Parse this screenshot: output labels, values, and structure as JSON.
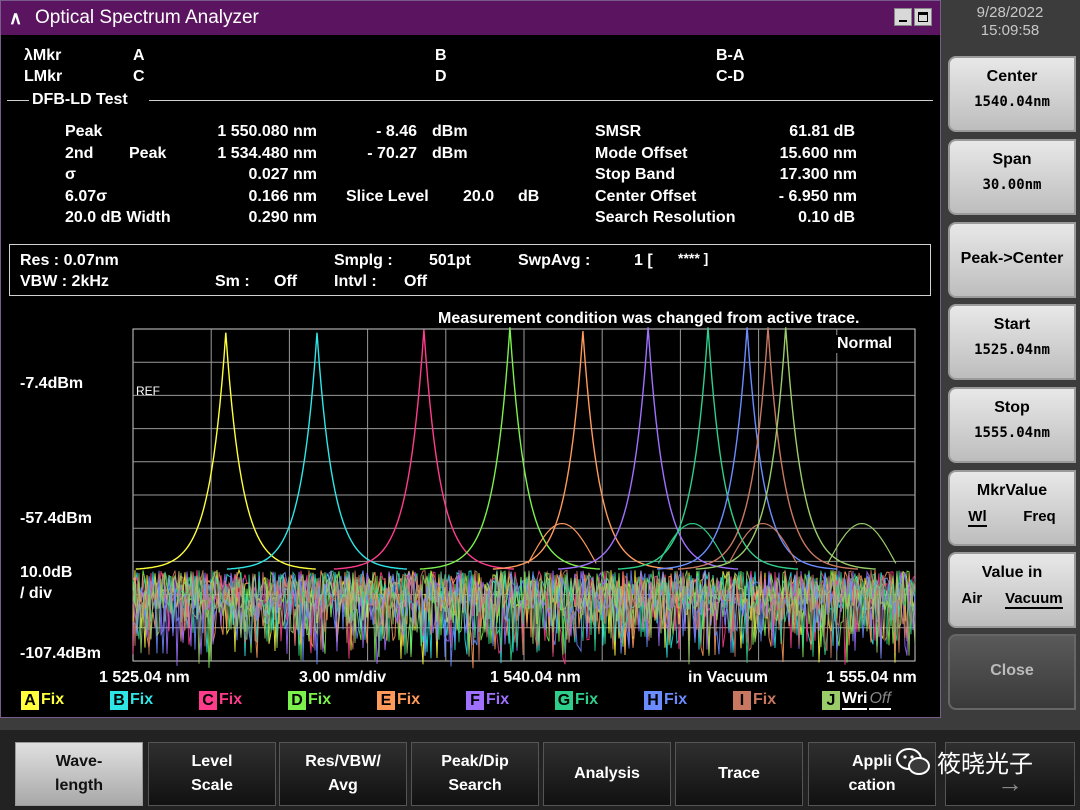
{
  "window": {
    "title": "Optical Spectrum Analyzer"
  },
  "markers": {
    "lmkr_label": "λMkr",
    "a": "A",
    "b": "B",
    "ba": "B-A",
    "lmkr2_label": "LMkr",
    "c": "C",
    "d": "D",
    "cd": "C-D"
  },
  "test": {
    "name": "DFB-LD Test",
    "peak_label": "Peak",
    "peak_wl": "1 550.080 nm",
    "peak_lvl": "- 8.46",
    "peak_unit": "dBm",
    "second_label": "2nd",
    "second_label2": "Peak",
    "second_wl": "1 534.480 nm",
    "second_lvl": "- 70.27",
    "second_unit": "dBm",
    "sigma_label": "σ",
    "sigma_val": "0.027 nm",
    "sigma6_label": "6.07σ",
    "sigma6_val": "0.166 nm",
    "slice_label": "Slice Level",
    "slice_val": "20.0",
    "slice_unit": "dB",
    "width_label": "20.0  dB Width",
    "width_val": "0.290 nm",
    "smsr_label": "SMSR",
    "smsr_val": "61.81 dB",
    "mode_offset_label": "Mode Offset",
    "mode_offset_val": "15.600 nm",
    "stop_band_label": "Stop Band",
    "stop_band_val": "17.300 nm",
    "center_offset_label": "Center Offset",
    "center_offset_val": "- 6.950 nm",
    "search_res_label": "Search Resolution",
    "search_res_val": "0.10 dB"
  },
  "conditions": {
    "res": "Res :  0.07nm",
    "vbw": "VBW :    2kHz",
    "sm_label": "Sm :",
    "sm_val": "Off",
    "smplg_label": "Smplg :",
    "smplg_val": "501pt",
    "intvl_label": "Intvl :",
    "intvl_val": "Off",
    "swpavg_label": "SwpAvg :",
    "swpavg_val": "1 [",
    "swpavg_count": "****  ]"
  },
  "message": "Measurement condition was changed from active trace.",
  "mode": "Normal",
  "axis": {
    "top_level": "-7.4dBm",
    "mid_level": "-57.4dBm",
    "scale": "10.0dB",
    "scale2": "/ div",
    "bottom_level": "-107.4dBm",
    "ref_label": "REF",
    "start": "1 525.04 nm",
    "per_div": "3.00 nm/div",
    "center": "1 540.04 nm",
    "medium": "in Vacuum",
    "stop": "1 555.04 nm"
  },
  "traces": [
    {
      "letter": "A",
      "status": "Fix",
      "color": "#ffff3c"
    },
    {
      "letter": "B",
      "status": "Fix",
      "color": "#2ee6e6"
    },
    {
      "letter": "C",
      "status": "Fix",
      "color": "#ff3c8c"
    },
    {
      "letter": "D",
      "status": "Fix",
      "color": "#7cf04c"
    },
    {
      "letter": "E",
      "status": "Fix",
      "color": "#ff9a5a"
    },
    {
      "letter": "F",
      "status": "Fix",
      "color": "#a070ff"
    },
    {
      "letter": "G",
      "status": "Fix",
      "color": "#2ecf8a"
    },
    {
      "letter": "H",
      "status": "Fix",
      "color": "#6a8cff"
    },
    {
      "letter": "I",
      "status": "Fix",
      "color": "#c87860"
    },
    {
      "letter": "J",
      "status": "Wri",
      "status2": "Off",
      "color": "#9acd6a"
    }
  ],
  "datetime": {
    "date": "9/28/2022",
    "time": "15:09:58"
  },
  "side_panel": {
    "center_label": "Center",
    "center_val": "1540.04nm",
    "span_label": "Span",
    "span_val": "30.00nm",
    "peak_center": "Peak->Center",
    "start_label": "Start",
    "start_val": "1525.04nm",
    "stop_label": "Stop",
    "stop_val": "1555.04nm",
    "mkr_value_label": "MkrValue",
    "mkr_opt1": "Wl",
    "mkr_opt2": "Freq",
    "value_in_label": "Value in",
    "value_opt1": "Air",
    "value_opt2": "Vacuum",
    "close_label": "Close"
  },
  "soft_keys": [
    {
      "line1": "Wave-",
      "line2": "length"
    },
    {
      "line1": "Level",
      "line2": "Scale"
    },
    {
      "line1": "Res/VBW/",
      "line2": "Avg"
    },
    {
      "line1": "Peak/Dip",
      "line2": "Search"
    },
    {
      "line1": "Analysis",
      "line2": ""
    },
    {
      "line1": "Trace",
      "line2": ""
    },
    {
      "line1": "Appli",
      "line2": "cation"
    }
  ],
  "watermark": "筱晓光子",
  "chart_data": {
    "type": "line",
    "xlabel": "",
    "ylabel": "",
    "xlim": [
      1525.04,
      1555.04
    ],
    "ylim": [
      -107.4,
      -7.4
    ],
    "xticks_labels": [
      "1 525.04 nm",
      "1 540.04 nm",
      "1 555.04 nm"
    ],
    "grid": true,
    "noise_floor_dbm": [
      -92,
      -80
    ],
    "series": [
      {
        "name": "A",
        "peak_wl": 1528.6,
        "peak_dbm": -8.5,
        "side_wl": null
      },
      {
        "name": "B",
        "peak_wl": 1532.1,
        "peak_dbm": -8.5,
        "side_wl": null
      },
      {
        "name": "C",
        "peak_wl": 1536.2,
        "peak_dbm": -7.6,
        "side_wl": null
      },
      {
        "name": "D",
        "peak_wl": 1539.5,
        "peak_dbm": -6.9,
        "side_wl": null
      },
      {
        "name": "E",
        "peak_wl": 1542.3,
        "peak_dbm": -8.0,
        "side_wl": 1541.5
      },
      {
        "name": "F",
        "peak_wl": 1544.8,
        "peak_dbm": -6.9,
        "side_wl": null
      },
      {
        "name": "G",
        "peak_wl": 1547.1,
        "peak_dbm": -6.9,
        "side_wl": 1546.5
      },
      {
        "name": "H",
        "peak_wl": 1548.6,
        "peak_dbm": -6.9,
        "side_wl": null
      },
      {
        "name": "I",
        "peak_wl": 1549.4,
        "peak_dbm": -6.9,
        "side_wl": 1549.2
      },
      {
        "name": "J",
        "peak_wl": 1550.08,
        "peak_dbm": -6.9,
        "side_wl": 1553.0
      }
    ]
  }
}
